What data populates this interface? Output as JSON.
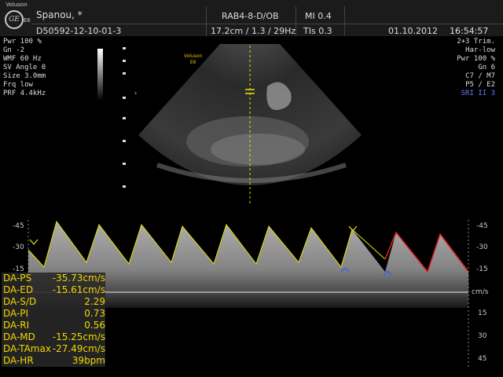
{
  "header": {
    "brand": "Voluson",
    "logo_mark": "GE",
    "model": "E6",
    "patient_name": "Spanou, *",
    "patient_id": "D50592-12-10-01-3",
    "probe_preset": "RAB4-8-D/OB",
    "imaging_params": "17.2cm / 1.3 / 29Hz",
    "mi": "MI 0.4",
    "tis": "TIs 0.3",
    "date": "01.10.2012",
    "time": "16:54:57"
  },
  "left_params": [
    "Pwr 100 %",
    "Gn  -2",
    "WMF 60 Hz",
    "SV Angle  0",
    "Size  3.0mm",
    "Frq low",
    "PRF  4.4kHz"
  ],
  "right_params": [
    "2+3 Trim.",
    "Har-low",
    "Pwr 100 %",
    "Gn   6",
    "C7 / M7",
    "P5 / E2"
  ],
  "right_params_highlight": "SRI II 3",
  "image_brand": [
    "Voluson",
    "E6"
  ],
  "doppler_scale": {
    "ticks_upper": [
      "-45",
      "-30",
      "-15"
    ],
    "ticks_lower": [
      "15",
      "30",
      "45"
    ],
    "unit": "cm/s"
  },
  "measurements": [
    {
      "label": "DA-PS",
      "value": "-35.73cm/s"
    },
    {
      "label": "DA-ED",
      "value": "-15.61cm/s"
    },
    {
      "label": "DA-S/D",
      "value": "2.29"
    },
    {
      "label": "DA-PI",
      "value": "0.73"
    },
    {
      "label": "DA-RI",
      "value": "0.56"
    },
    {
      "label": "DA-MD",
      "value": "-15.25cm/s"
    },
    {
      "label": "DA-TAmax",
      "value": "-27.49cm/s"
    },
    {
      "label": "DA-HR",
      "value": "39bpm"
    }
  ],
  "colors": {
    "trace_yellow": "#e8e000",
    "trace_red": "#e02020",
    "marker_blue": "#3a5cff",
    "measure_text": "#f1d800",
    "sri_blue": "#6b7dff"
  }
}
